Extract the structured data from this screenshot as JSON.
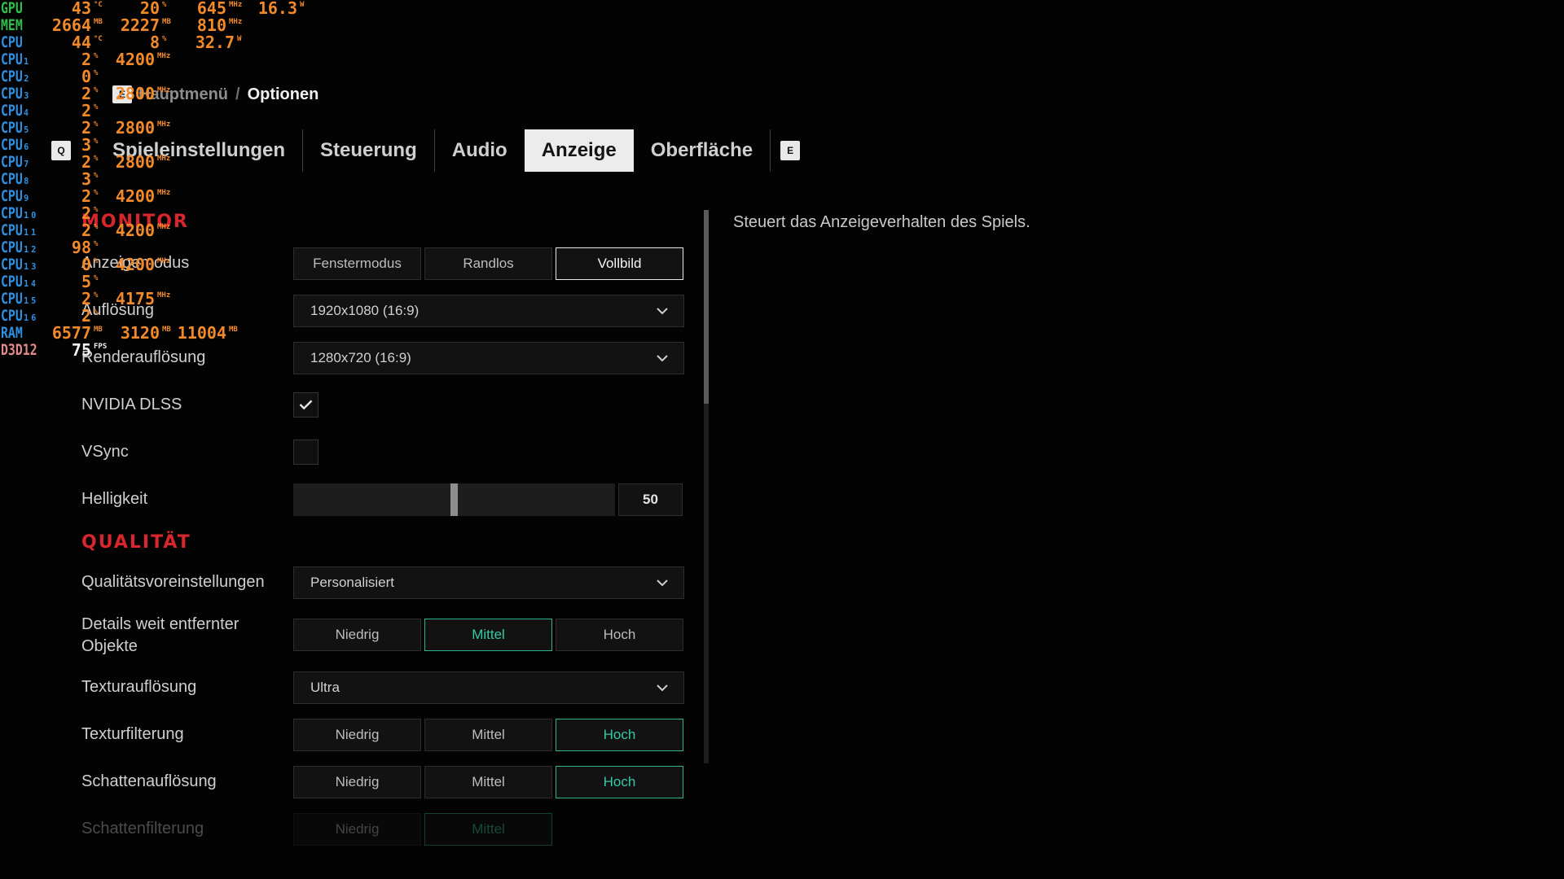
{
  "osd": [
    {
      "label": "GPU",
      "label_color": "#2fbf4a",
      "values": [
        {
          "v": "43",
          "u": "°C"
        },
        {
          "v": "20",
          "u": "%"
        },
        {
          "v": "645",
          "u": "MHz"
        },
        {
          "v": "16.3",
          "u": "W"
        }
      ]
    },
    {
      "label": "MEM",
      "label_color": "#2fbf4a",
      "values": [
        {
          "v": "2664",
          "u": "MB"
        },
        {
          "v": "2227",
          "u": "MB"
        },
        {
          "v": "810",
          "u": "MHz"
        }
      ]
    },
    {
      "label": "CPU",
      "label_color": "#2f8fe0",
      "values": [
        {
          "v": "44",
          "u": "°C"
        },
        {
          "v": "8",
          "u": "%"
        },
        {
          "v": "32.7",
          "u": "W"
        }
      ]
    },
    {
      "label": "CPU₁",
      "label_color": "#2f8fe0",
      "values": [
        {
          "v": "2",
          "u": "%"
        },
        {
          "v": "4200",
          "u": "MHz"
        }
      ]
    },
    {
      "label": "CPU₂",
      "label_color": "#2f8fe0",
      "values": [
        {
          "v": "0",
          "u": "%"
        }
      ]
    },
    {
      "label": "CPU₃",
      "label_color": "#2f8fe0",
      "values": [
        {
          "v": "2",
          "u": "%"
        },
        {
          "v": "2800",
          "u": "MHz"
        }
      ]
    },
    {
      "label": "CPU₄",
      "label_color": "#2f8fe0",
      "values": [
        {
          "v": "2",
          "u": "%"
        }
      ]
    },
    {
      "label": "CPU₅",
      "label_color": "#2f8fe0",
      "values": [
        {
          "v": "2",
          "u": "%"
        },
        {
          "v": "2800",
          "u": "MHz"
        }
      ]
    },
    {
      "label": "CPU₆",
      "label_color": "#2f8fe0",
      "values": [
        {
          "v": "3",
          "u": "%"
        }
      ]
    },
    {
      "label": "CPU₇",
      "label_color": "#2f8fe0",
      "values": [
        {
          "v": "2",
          "u": "%"
        },
        {
          "v": "2800",
          "u": "MHz"
        }
      ]
    },
    {
      "label": "CPU₈",
      "label_color": "#2f8fe0",
      "values": [
        {
          "v": "3",
          "u": "%"
        }
      ]
    },
    {
      "label": "CPU₉",
      "label_color": "#2f8fe0",
      "values": [
        {
          "v": "2",
          "u": "%"
        },
        {
          "v": "4200",
          "u": "MHz"
        }
      ]
    },
    {
      "label": "CPU₁₀",
      "label_color": "#2f8fe0",
      "values": [
        {
          "v": "2",
          "u": "%"
        }
      ]
    },
    {
      "label": "CPU₁₁",
      "label_color": "#2f8fe0",
      "values": [
        {
          "v": "2",
          "u": "%"
        },
        {
          "v": "4200",
          "u": "MHz"
        }
      ]
    },
    {
      "label": "CPU₁₂",
      "label_color": "#2f8fe0",
      "values": [
        {
          "v": "98",
          "u": "%"
        }
      ]
    },
    {
      "label": "CPU₁₃",
      "label_color": "#2f8fe0",
      "values": [
        {
          "v": "0",
          "u": "%"
        },
        {
          "v": "4200",
          "u": "MHz"
        }
      ]
    },
    {
      "label": "CPU₁₄",
      "label_color": "#2f8fe0",
      "values": [
        {
          "v": "5",
          "u": "%"
        }
      ]
    },
    {
      "label": "CPU₁₅",
      "label_color": "#2f8fe0",
      "values": [
        {
          "v": "2",
          "u": "%"
        },
        {
          "v": "4175",
          "u": "MHz"
        }
      ]
    },
    {
      "label": "CPU₁₆",
      "label_color": "#2f8fe0",
      "values": [
        {
          "v": "2",
          "u": "%"
        }
      ]
    },
    {
      "label": "RAM",
      "label_color": "#2f8fe0",
      "values": [
        {
          "v": "6577",
          "u": "MB"
        },
        {
          "v": "3120",
          "u": "MB"
        },
        {
          "v": "11004",
          "u": "MB"
        }
      ]
    },
    {
      "label": "D3D12",
      "label_color": "#e58a8a",
      "values": [
        {
          "v": "75",
          "u": "FPS"
        }
      ]
    }
  ],
  "breadcrumb": {
    "back_key": "E",
    "parent": "Hauptmenü",
    "separator": "/",
    "current": "Optionen"
  },
  "tabs": {
    "prev_key": "Q",
    "next_key": "E",
    "items": [
      {
        "label": "Spieleinstellungen",
        "active": false
      },
      {
        "label": "Steuerung",
        "active": false
      },
      {
        "label": "Audio",
        "active": false
      },
      {
        "label": "Anzeige",
        "active": true
      },
      {
        "label": "Oberfläche",
        "active": false
      }
    ]
  },
  "sections": {
    "monitor": "MONITOR",
    "quality": "QUALITÄT"
  },
  "settings": {
    "display_mode": {
      "label": "Anzeigemodus",
      "options": [
        "Fenstermodus",
        "Randlos",
        "Vollbild"
      ],
      "selected": 2
    },
    "resolution": {
      "label": "Auflösung",
      "value": "1920x1080 (16:9)"
    },
    "render_resolution": {
      "label": "Renderauflösung",
      "value": "1280x720 (16:9)"
    },
    "dlss": {
      "label": "NVIDIA DLSS",
      "checked": true
    },
    "vsync": {
      "label": "VSync",
      "checked": false
    },
    "brightness": {
      "label": "Helligkeit",
      "value": "50",
      "fraction": 0.5
    },
    "quality_preset": {
      "label": "Qualitätsvoreinstellungen",
      "value": "Personalisiert"
    },
    "far_object_detail": {
      "label": "Details weit entfernter Objekte",
      "options": [
        "Niedrig",
        "Mittel",
        "Hoch"
      ],
      "selected": 1
    },
    "texture_resolution": {
      "label": "Texturauflösung",
      "value": "Ultra"
    },
    "texture_filtering": {
      "label": "Texturfilterung",
      "options": [
        "Niedrig",
        "Mittel",
        "Hoch"
      ],
      "selected": 2
    },
    "shadow_resolution": {
      "label": "Schattenauflösung",
      "options": [
        "Niedrig",
        "Mittel",
        "Hoch"
      ],
      "selected": 2
    },
    "shadow_filtering": {
      "label": "Schattenfilterung",
      "options": [
        "Niedrig",
        "Mittel"
      ],
      "selected": 1
    }
  },
  "description": "Steuert das Anzeigeverhalten des Spiels.",
  "colors": {
    "accent_red": "#d9252c",
    "accent_teal": "#36c9a6",
    "osd_value": "#f28a2a"
  }
}
